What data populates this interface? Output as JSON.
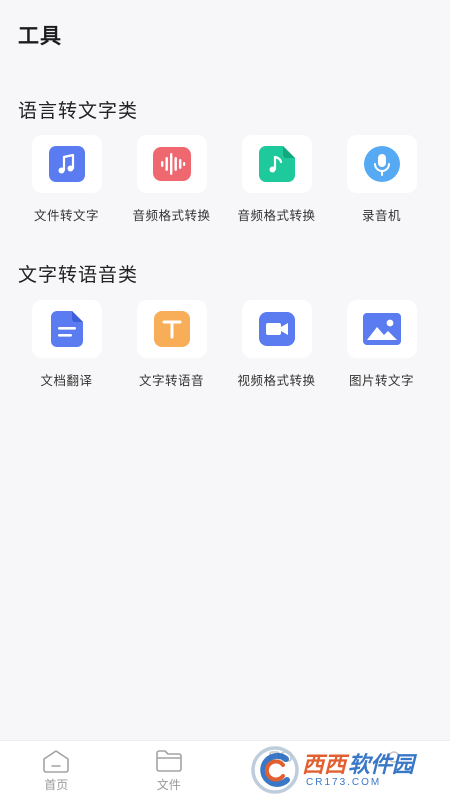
{
  "header": {
    "title": "工具"
  },
  "sections": [
    {
      "title": "语言转文字类",
      "tools": [
        {
          "label": "文件转文字",
          "icon": "music-note-icon",
          "color": "#5b7cf0"
        },
        {
          "label": "音频格式转换",
          "icon": "sound-wave-icon",
          "color": "#f0686f"
        },
        {
          "label": "音频格式转换",
          "icon": "music-file-icon",
          "color": "#1ec99b"
        },
        {
          "label": "录音机",
          "icon": "microphone-icon",
          "color": "#55aaf3"
        }
      ]
    },
    {
      "title": "文字转语音类",
      "tools": [
        {
          "label": "文档翻译",
          "icon": "document-icon",
          "color": "#5b7cf0"
        },
        {
          "label": "文字转语音",
          "icon": "text-t-icon",
          "color": "#f8ad58"
        },
        {
          "label": "视频格式转换",
          "icon": "video-camera-icon",
          "color": "#5b7cf0"
        },
        {
          "label": "图片转文字",
          "icon": "image-icon",
          "color": "#5b7cf0"
        }
      ]
    }
  ],
  "tab_bar": {
    "tabs": [
      {
        "label": "首页",
        "icon": "home-icon"
      },
      {
        "label": "文件",
        "icon": "folder-icon"
      },
      {
        "label": "",
        "icon": "tools-icon"
      },
      {
        "label": "",
        "icon": "profile-icon"
      }
    ]
  },
  "watermark": {
    "text_a": "西西",
    "text_b": "软件园",
    "sub": "CR173.COM"
  }
}
